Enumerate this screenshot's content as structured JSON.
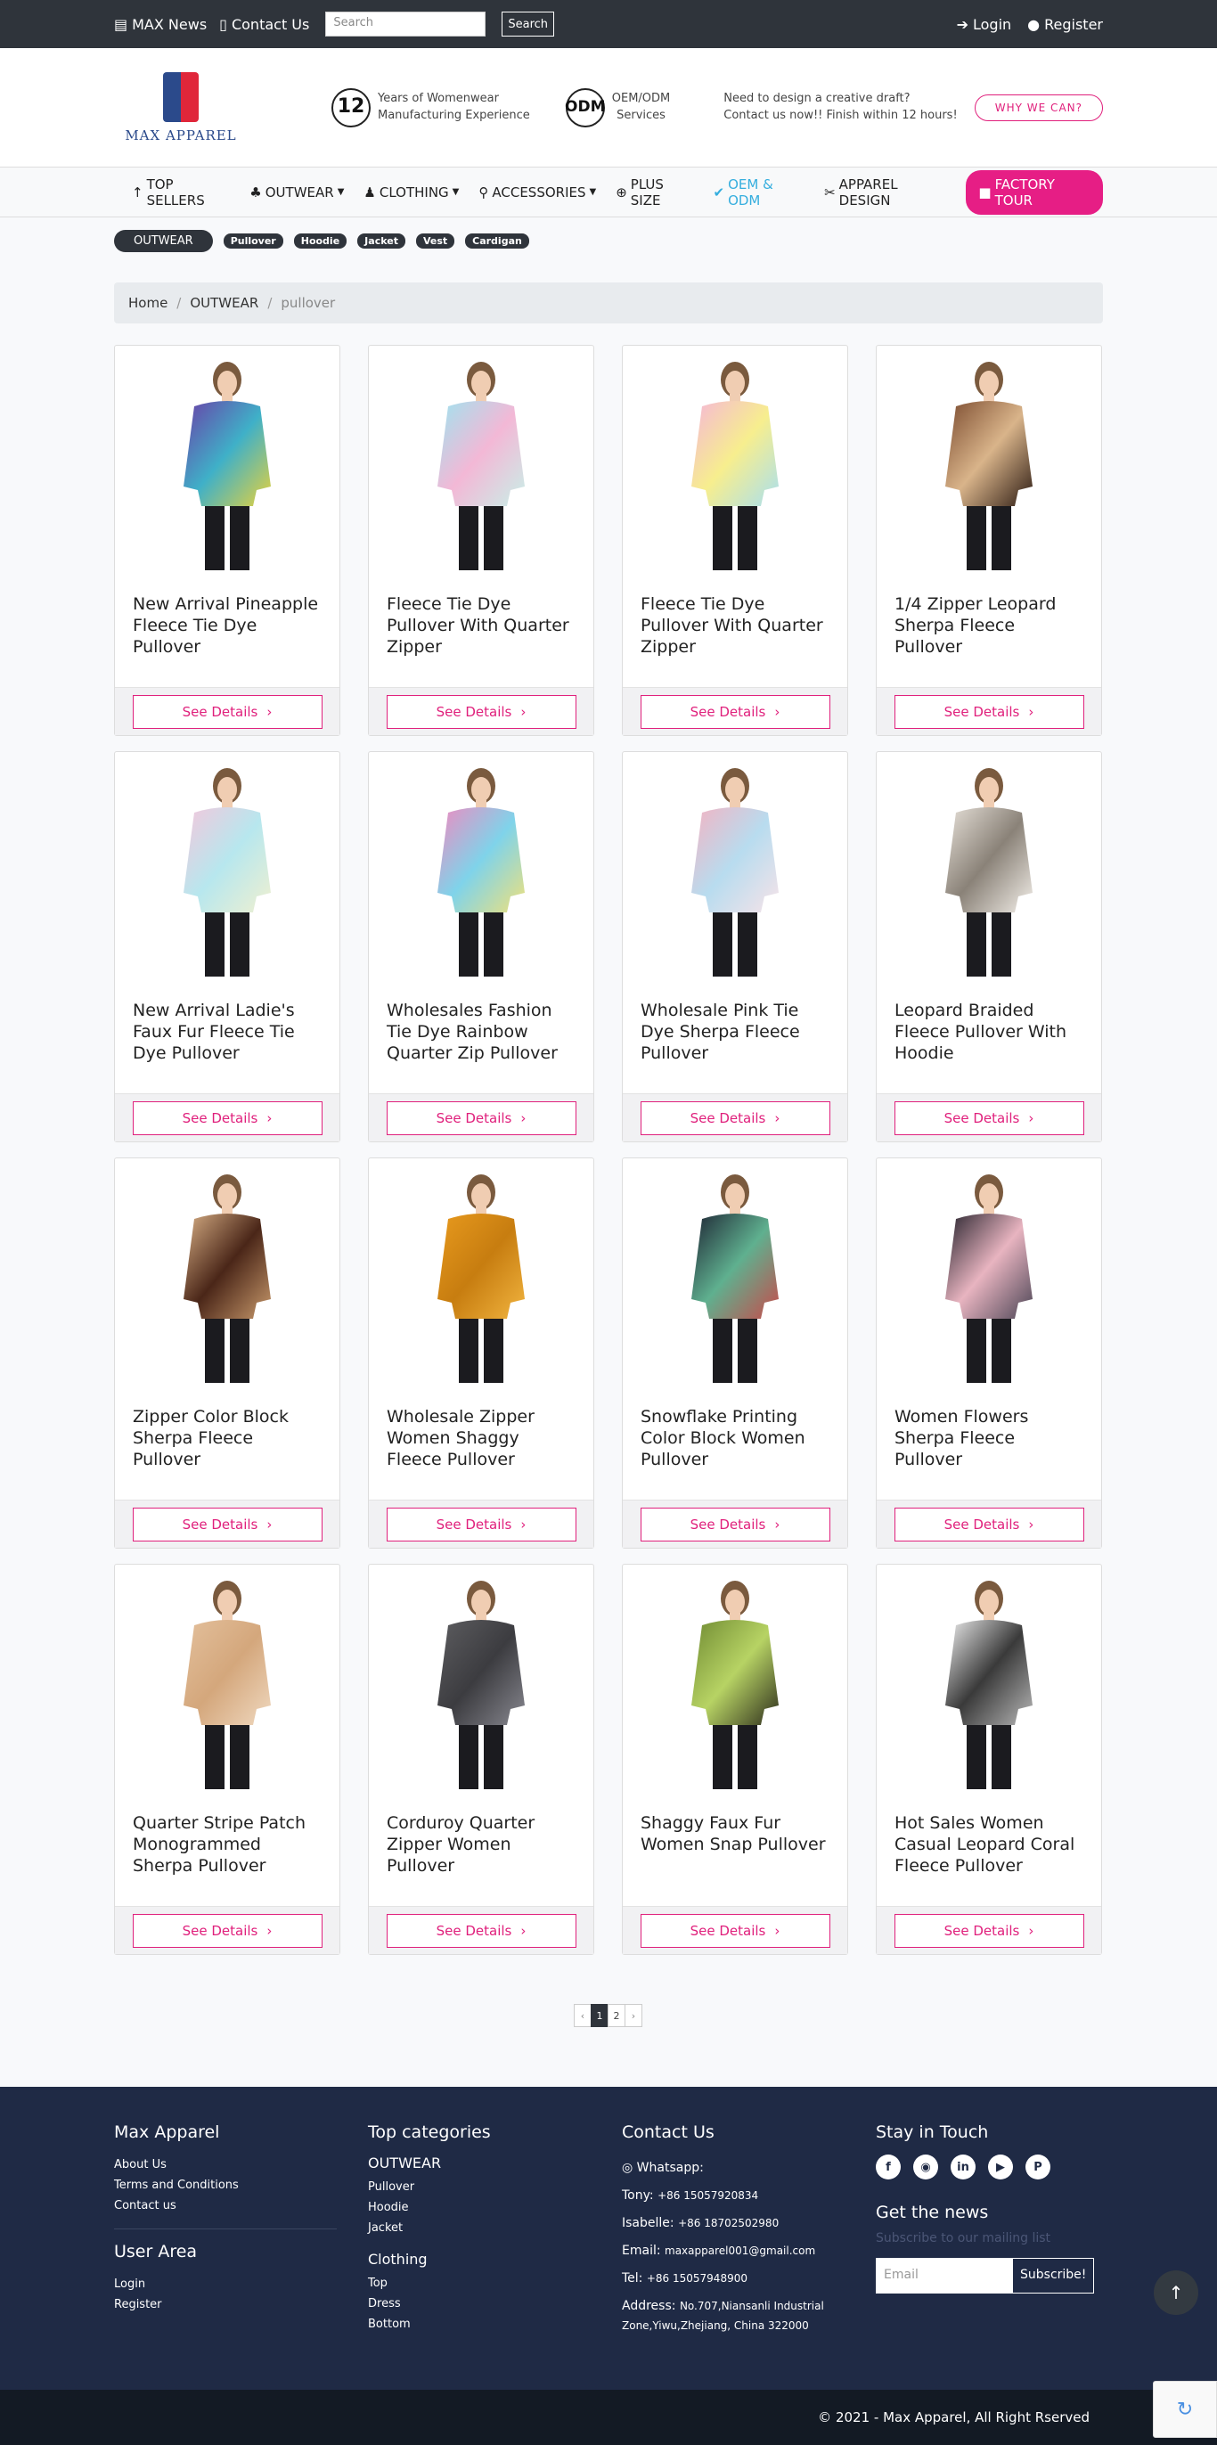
{
  "topbar": {
    "news": "MAX News",
    "contact": "Contact Us",
    "search_placeholder": "Search",
    "search_button": "Search",
    "login": "Login",
    "register": "Register"
  },
  "header": {
    "logo_text": "MAX APPAREL",
    "years": "12",
    "years_text_1": "Years of Womenwear",
    "years_text_2": "Manufacturing Experience",
    "odm": "ODM",
    "odm_text_1": "OEM/ODM",
    "odm_text_2": "Services",
    "draft_1": "Need to design a creative draft?",
    "draft_2": "Contact us now!! Finish within 12 hours!",
    "why_button": "WHY WE CAN?"
  },
  "nav": {
    "top_sellers": "TOP SELLERS",
    "outwear": "OUTWEAR",
    "clothing": "CLOTHING",
    "accessories": "ACCESSORIES",
    "plus_size": "PLUS SIZE",
    "oem_odm": "OEM & ODM",
    "apparel_design": "APPAREL DESIGN",
    "factory_tour": "FACTORY TOUR"
  },
  "categories": {
    "main": "OUTWEAR",
    "pills": [
      "Pullover",
      "Hoodie",
      "Jacket",
      "Vest",
      "Cardigan"
    ]
  },
  "breadcrumb": {
    "home": "Home",
    "section": "OUTWEAR",
    "current": "pullover"
  },
  "products": [
    {
      "title": "New Arrival Pineapple Fleece Tie Dye Pullover",
      "button": "See Details",
      "c1": "#6a3fa8",
      "c2": "#3fb0c8",
      "c3": "#e8d23b"
    },
    {
      "title": "Fleece Tie Dye Pullover With Quarter Zipper",
      "button": "See Details",
      "c1": "#9fe3ef",
      "c2": "#f3b8d6",
      "c3": "#c8f0e8"
    },
    {
      "title": "Fleece Tie Dye Pullover With Quarter Zipper",
      "button": "See Details",
      "c1": "#f5b6d8",
      "c2": "#f7ee8e",
      "c3": "#a8dff0"
    },
    {
      "title": "1/4 Zipper Leopard Sherpa Fleece Pullover",
      "button": "See Details",
      "c1": "#7a4a2e",
      "c2": "#d9b48a",
      "c3": "#2b1a12"
    },
    {
      "title": "New Arrival Ladie's Faux Fur Fleece Tie Dye Pullover",
      "button": "See Details",
      "c1": "#f4c7dc",
      "c2": "#b7e7ee",
      "c3": "#f0f0d0"
    },
    {
      "title": "Wholesales Fashion Tie Dye Rainbow Quarter Zip Pullover",
      "button": "See Details",
      "c1": "#f08ac0",
      "c2": "#7fd3ea",
      "c3": "#f0e17a"
    },
    {
      "title": "Wholesale Pink Tie Dye Sherpa Fleece Pullover",
      "button": "See Details",
      "c1": "#f4b3c2",
      "c2": "#b8dcef",
      "c3": "#f7e3e8"
    },
    {
      "title": "Leopard Braided Fleece Pullover With Hoodie",
      "button": "See Details",
      "c1": "#e8e2da",
      "c2": "#8a8278",
      "c3": "#f4f0ea"
    },
    {
      "title": "Zipper Color Block Sherpa Fleece Pullover",
      "button": "See Details",
      "c1": "#d9b086",
      "c2": "#4a2618",
      "c3": "#c99a6c"
    },
    {
      "title": "Wholesale Zipper Women Shaggy Fleece Pullover",
      "button": "See Details",
      "c1": "#e89a1e",
      "c2": "#c77d10",
      "c3": "#f2b540"
    },
    {
      "title": "Snowflake Printing Color Block Women Pullover",
      "button": "See Details",
      "c1": "#1c2232",
      "c2": "#5fb08f",
      "c3": "#c84a4a"
    },
    {
      "title": "Women Flowers Sherpa Fleece Pullover",
      "button": "See Details",
      "c1": "#23202a",
      "c2": "#e8b4c0",
      "c3": "#4a4454"
    },
    {
      "title": "Quarter Stripe Patch Monogrammed Sherpa Pullover",
      "button": "See Details",
      "c1": "#e3c09c",
      "c2": "#d4a77c",
      "c3": "#f0d9c0"
    },
    {
      "title": "Corduroy Quarter Zipper Women Pullover",
      "button": "See Details",
      "c1": "#5d5d60",
      "c2": "#3c3c40",
      "c3": "#888890"
    },
    {
      "title": "Shaggy Faux Fur Women Snap Pullover",
      "button": "See Details",
      "c1": "#6f8a32",
      "c2": "#b7d364",
      "c3": "#2c2c1c"
    },
    {
      "title": "Hot Sales Women Casual Leopard Coral Fleece Pullover",
      "button": "See Details",
      "c1": "#f0f0f0",
      "c2": "#3a3a3a",
      "c3": "#b8b8b8"
    }
  ],
  "pagination": {
    "prev": "‹",
    "page1": "1",
    "page2": "2",
    "next": "›"
  },
  "footer": {
    "about_title": "Max Apparel",
    "about_links": [
      "About Us",
      "Terms and Conditions",
      "Contact us"
    ],
    "user_title": "User Area",
    "user_links": [
      "Login",
      "Register"
    ],
    "cat_title": "Top categories",
    "outwear_title": "OUTWEAR",
    "outwear_links": [
      "Pullover",
      "Hoodie",
      "Jacket"
    ],
    "clothing_title": "Clothing",
    "clothing_links": [
      "Top",
      "Dress",
      "Bottom"
    ],
    "contact_title": "Contact Us",
    "whatsapp": "Whatsapp:",
    "tony_label": "Tony:",
    "tony": "+86 15057920834",
    "isabelle_label": "Isabelle:",
    "isabelle": "+86 18702502980",
    "email_label": "Email:",
    "email": "maxapparel001@gmail.com",
    "tel_label": "Tel:",
    "tel": "+86 15057948900",
    "address_label": "Address:",
    "address_1": "No.707,Niansanli Industrial",
    "address_2": "Zone,Yiwu,Zhejiang, China 322000",
    "stay_title": "Stay in Touch",
    "news_title": "Get the news",
    "news_sub": "Subscribe to our mailing list",
    "email_placeholder": "Email",
    "subscribe_button": "Subscribe!"
  },
  "copyright": "© 2021 - Max Apparel, All Right Rserved"
}
